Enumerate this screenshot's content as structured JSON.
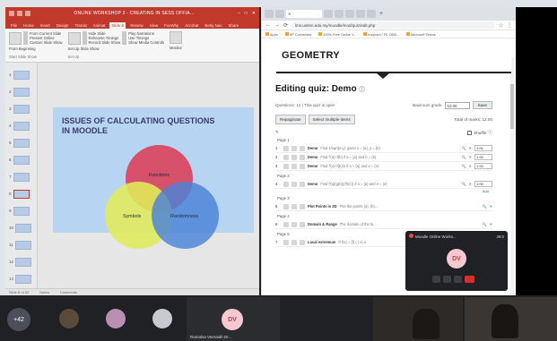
{
  "powerpoint": {
    "title": "ONLINE WORKSHOP 2 - CREATING IN SESS OFFIA...",
    "tabs": [
      "File",
      "Home",
      "Insert",
      "Design",
      "Transit",
      "Animat",
      "Slide S",
      "Review",
      "View",
      "FoxWhy",
      "Acrobat",
      "Betty Nav"
    ],
    "active_tab": "Slide S",
    "share": "Share",
    "ribbon": {
      "from_beginning": "From Beginning",
      "from_current": "From Current Slide",
      "present_online": "Present Online",
      "custom_show": "Custom Slide Show",
      "group1": "Start Slide Show",
      "setup": "Set Up Slide Show",
      "hide_slide": "Hide Slide",
      "rehearse": "Rehearse Timings",
      "record": "Record Slide Show",
      "play_narrations": "Play Narrations",
      "use_timings": "Use Timings",
      "show_media": "Show Media Controls",
      "group2": "Set Up",
      "monitor": "Monitor"
    },
    "thumb_numbers": [
      "1",
      "2",
      "3",
      "4",
      "5",
      "6",
      "7",
      "8",
      "9",
      "10",
      "11",
      "12",
      "13"
    ],
    "selected_thumb": "8",
    "slide": {
      "title_line1": "ISSUES OF CALCULATING QUESTIONS",
      "title_line2": "IN MOODLE",
      "labels": [
        "Functions",
        "Symbols",
        "Randomness"
      ]
    },
    "status": [
      "Slide 8 of 52",
      "Notes",
      "Comments"
    ]
  },
  "browser": {
    "url": "lms.uniten.edu.my/moodle/mod/quiz/edit.php",
    "bookmarks": [
      "Apps",
      "HP Connected",
      "100% Free Online V...",
      "Insyiram / FE ODB...",
      "Microsoft Teams"
    ],
    "geometry_title": "GEOMETRY",
    "quiz": {
      "heading": "Editing quiz: Demo",
      "questions_info": "Questions: 12 | This quiz is open",
      "max_grade_label": "Maximum grade",
      "max_grade_value": "10.00",
      "save": "Save",
      "repaginate": "Repaginate",
      "select_multiple": "Select multiple items",
      "total_marks": "Total of marks: 12.00",
      "shuffle": "Shuffle",
      "add": "Add",
      "rows": [
        {
          "page": "Page 1",
          "num": "1",
          "name": "Demo",
          "text": "Find 1/sqrt(x-y), given x = {a}, y = {b}",
          "mark": "1.00"
        },
        {
          "page": "",
          "num": "2",
          "name": "Demo",
          "text": "Find f'(a)+f(b) if a = {a} and b = {b}",
          "mark": "1.00"
        },
        {
          "page": "",
          "num": "3",
          "name": "Demo",
          "text": "Find f'(x)+f(b)/2 if a = {a} and x = {x}",
          "mark": "1.00"
        },
        {
          "page": "Page 2",
          "num": "4",
          "name": "Demo",
          "text": "Find f'(a)(g(b))/(h(c)) if a = {a} and e = {e}",
          "mark": "1.00"
        },
        {
          "page": "Page 3",
          "num": "5",
          "name": "Plot Points in 3D",
          "text": "Plot the points (a), (b)...",
          "mark": ""
        },
        {
          "page": "Page 4",
          "num": "6",
          "name": "Domain & Range",
          "text": "The domain of the fu...",
          "mark": ""
        },
        {
          "page": "Page 5",
          "num": "7",
          "name": "Local extremum",
          "text": "If f(x) = {f} ( ) is a",
          "mark": ""
        }
      ]
    }
  },
  "meet": {
    "title": "Moodle Online Works...",
    "time": "29:0",
    "avatar_initials": "DV"
  },
  "participants": {
    "overflow": "+42",
    "dv_initials": "DV",
    "dv_name": "Ramalsa Veeraiah Dr..."
  }
}
